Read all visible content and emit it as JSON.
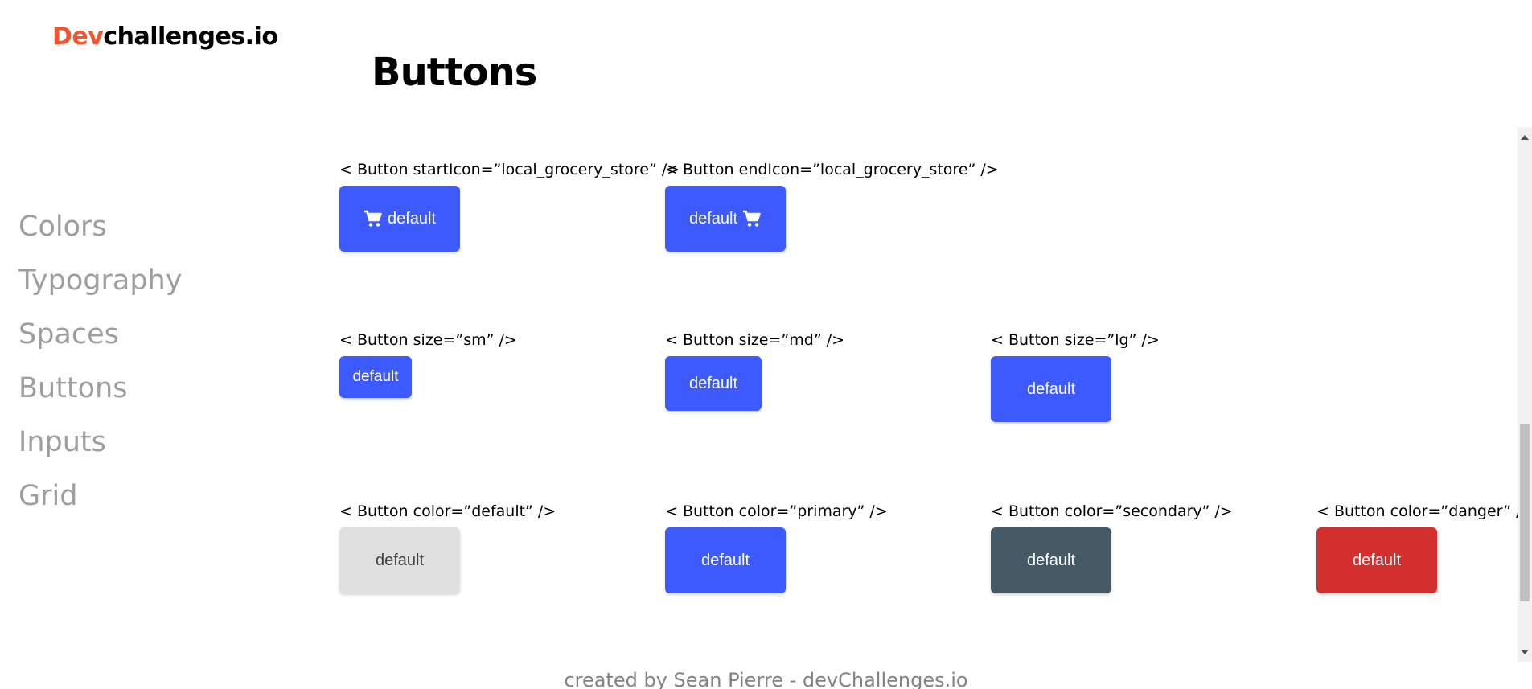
{
  "logo": {
    "accent": "Dev",
    "rest": "challenges.io"
  },
  "sidebar": {
    "items": [
      {
        "label": "Colors"
      },
      {
        "label": "Typography"
      },
      {
        "label": "Spaces"
      },
      {
        "label": "Buttons"
      },
      {
        "label": "Inputs"
      },
      {
        "label": "Grid"
      }
    ]
  },
  "main": {
    "title": "Buttons",
    "icon_rows": {
      "start": {
        "label": "< Button startIcon=”local_grocery_store” />",
        "button": "default",
        "icon": "cart-icon"
      },
      "end": {
        "label": "< Button endIcon=”local_grocery_store” />",
        "button": "default",
        "icon": "cart-icon"
      }
    },
    "size_rows": {
      "sm": {
        "label": "< Button size=”sm” />",
        "button": "default"
      },
      "md": {
        "label": "< Button size=”md” />",
        "button": "default"
      },
      "lg": {
        "label": "< Button size=”lg” />",
        "button": "default"
      }
    },
    "color_rows": {
      "default": {
        "label": "< Button color=”default” />",
        "button": "default"
      },
      "primary": {
        "label": "< Button color=”primary” />",
        "button": "default"
      },
      "secondary": {
        "label": "< Button color=”secondary” />",
        "button": "default"
      },
      "danger": {
        "label": "< Button color=”danger” />",
        "button": "default"
      }
    }
  },
  "footer": {
    "text": "created by Sean Pierre - devChallenges.io"
  },
  "colors": {
    "brand_accent": "#F7542E",
    "primary": "#3D5AFE",
    "default": "#E0E0E0",
    "secondary": "#455A64",
    "danger": "#D32F2F",
    "nav_text": "#9E9E9E"
  }
}
